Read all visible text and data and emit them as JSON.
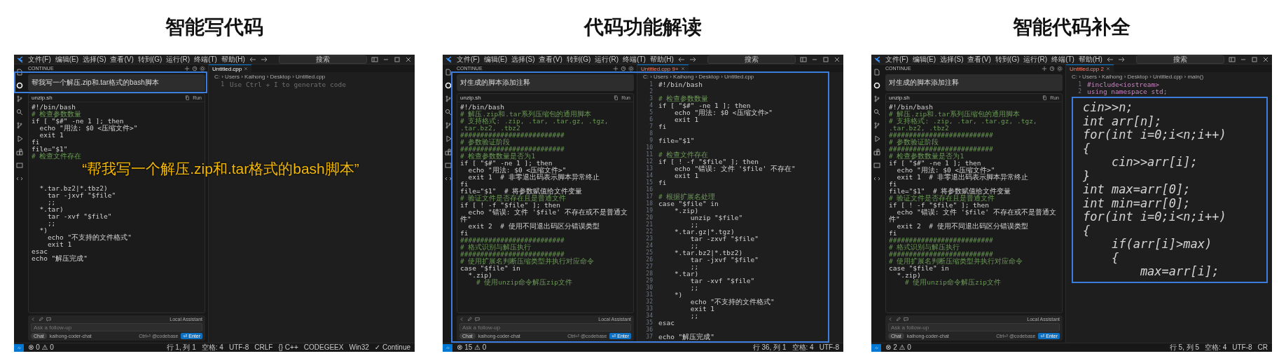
{
  "panels": [
    {
      "title": "智能写代码",
      "highlight": {
        "kind": "prompt"
      },
      "caption": "“帮我写一个解压.zip和.tar格式的bash脚本”",
      "screen": {
        "menu": [
          "文件(F)",
          "编辑(E)",
          "选择(S)",
          "查看(V)",
          "转到(G)",
          "运行(R)",
          "终端(T)",
          "帮助(H)"
        ],
        "search": "搜索",
        "sidebar_header": "CONTINUE",
        "tab": {
          "label": "Untitled.cpp"
        },
        "breadcrumb": "C: › Users › Kaihong › Desktop › Untitled.cpp",
        "prompt": "帮我写一个解压.zip和.tar格式的bash脚本",
        "code_file": "unzip.sh",
        "run": "Run",
        "chat_code": [
          {
            "text": "#!/bin/bash",
            "kind": "code"
          },
          {
            "text": "# 检查参数数量",
            "kind": "comment"
          },
          {
            "text": "if [ \"$#\" -ne 1 ]; then",
            "kind": "code"
          },
          {
            "text": "  echo \"用法: $0 <压缩文件>\"",
            "kind": "code"
          },
          {
            "text": "  exit 1",
            "kind": "code"
          },
          {
            "text": "fi",
            "kind": "code"
          },
          {
            "text": "file=\"$1\"",
            "kind": "code"
          },
          {
            "text": "# 检查文件存在",
            "kind": "comment"
          }
        ],
        "chat_code_below": [
          {
            "text": "  *.tar.bz2|*.tbz2)",
            "kind": "code"
          },
          {
            "text": "    tar -jxvf \"$file\"",
            "kind": "code"
          },
          {
            "text": "    ;;",
            "kind": "code"
          },
          {
            "text": "  *.tar)",
            "kind": "code"
          },
          {
            "text": "    tar -xvf \"$file\"",
            "kind": "code"
          },
          {
            "text": "    ;;",
            "kind": "code"
          },
          {
            "text": "  *)",
            "kind": "code"
          },
          {
            "text": "    echo \"不支持的文件格式\"",
            "kind": "code"
          },
          {
            "text": "    exit 1",
            "kind": "code"
          },
          {
            "text": "esac",
            "kind": "code"
          },
          {
            "text": "echo \"解压完成\"",
            "kind": "code"
          }
        ],
        "assistant": "Local Assistant",
        "followup_placeholder": "Ask a follow-up",
        "chat_mode": "Chat",
        "model": "kaihong-coder-chat",
        "shortcut": "Ctrl⏎ @codebase",
        "enter": "⏎ Enter",
        "editor_lines": [
          {
            "n": "1",
            "text": "Use Ctrl + I to generate code",
            "kind": "hint"
          }
        ],
        "status_left": "⊗ 0 ⚠ 0",
        "status_right": [
          "行 1, 列 1",
          "空格: 4",
          "UTF-8",
          "CRLF",
          "{} C++",
          "CODEGEEX",
          "Win32",
          "✓ Continue"
        ]
      }
    },
    {
      "title": "代码功能解读",
      "highlight": {
        "kind": "workspace"
      },
      "screen": {
        "menu": [
          "文件(F)",
          "编辑(E)",
          "选择(S)",
          "查看(V)",
          "转到(G)",
          "运行(R)",
          "终端(T)",
          "帮助(H)"
        ],
        "search": "搜索",
        "sidebar_header": "CONTINUE",
        "tab": {
          "label": "Untitled.cpp",
          "problems": "9+"
        },
        "breadcrumb": "C: › Users › Kaihong › Desktop › Untitled.cpp",
        "prompt": "对生成的脚本添加注释",
        "code_file": "unzip.sh",
        "run": "Run",
        "chat_code": [
          {
            "text": "#!/bin/bash",
            "kind": "code"
          },
          {
            "text": "# 解压.zip和.tar系列压缩包的通用脚本",
            "kind": "comment"
          },
          {
            "text": "# 支持格式: .zip, .tar, .tar.gz, .tgz, .tar.bz2, .tbz2",
            "kind": "comment"
          },
          {
            "text": "##########################",
            "kind": "comment"
          },
          {
            "text": "# 参数验证阶段",
            "kind": "comment"
          },
          {
            "text": "##########################",
            "kind": "comment"
          },
          {
            "text": "# 检查参数数量是否为1",
            "kind": "comment"
          },
          {
            "text": "if [ \"$#\" -ne 1 ]; then",
            "kind": "code"
          },
          {
            "text": "  echo \"用法: $0 <压缩文件>\"",
            "kind": "code"
          },
          {
            "text": "  exit 1  # 非零退出码表示脚本异常终止",
            "kind": "code"
          },
          {
            "text": "fi",
            "kind": "code"
          },
          {
            "text": "file=\"$1\"  # 将参数赋值给文件变量",
            "kind": "code"
          },
          {
            "text": "# 验证文件是否存在且是普通文件",
            "kind": "comment"
          },
          {
            "text": "if [ ! -f \"$file\" ]; then",
            "kind": "code"
          },
          {
            "text": "  echo \"错误: 文件 '$file' 不存在或不是普通文件\"",
            "kind": "code"
          },
          {
            "text": "  exit 2  # 使用不同退出码区分错误类型",
            "kind": "code"
          },
          {
            "text": "fi",
            "kind": "code"
          },
          {
            "text": "##########################",
            "kind": "comment"
          },
          {
            "text": "# 格式识别与解压执行",
            "kind": "comment"
          },
          {
            "text": "##########################",
            "kind": "comment"
          },
          {
            "text": "# 使用扩展名判断压缩类型并执行对应命令",
            "kind": "comment"
          },
          {
            "text": "case \"$file\" in",
            "kind": "code"
          },
          {
            "text": "  *.zip)",
            "kind": "code"
          },
          {
            "text": "    # 使用unzip命令解压zip文件",
            "kind": "comment"
          }
        ],
        "assistant": "Local Assistant",
        "followup_placeholder": "Ask a follow-up",
        "chat_mode": "Chat",
        "model": "kaihong-coder-chat",
        "shortcut": "Ctrl⏎ @codebase",
        "enter": "⏎ Enter",
        "editor_lines": [
          {
            "n": "1",
            "text": "#!/bin/bash",
            "kind": "code"
          },
          {
            "n": "2"
          },
          {
            "n": "3",
            "text": "# 检查参数数量",
            "kind": "comment"
          },
          {
            "n": "4",
            "text": "if [ \"$#\" -ne 1 ]; then",
            "kind": "code"
          },
          {
            "n": "5",
            "text": "    echo \"用法: $0 <压缩文件>\"",
            "kind": "code"
          },
          {
            "n": "6",
            "text": "    exit 1",
            "kind": "code"
          },
          {
            "n": "7",
            "text": "fi",
            "kind": "code"
          },
          {
            "n": "8"
          },
          {
            "n": "9",
            "text": "file=\"$1\"",
            "kind": "code"
          },
          {
            "n": "10"
          },
          {
            "n": "11",
            "text": "# 检查文件存在",
            "kind": "comment"
          },
          {
            "n": "12",
            "text": "if [ ! -f \"$file\" ]; then",
            "kind": "code"
          },
          {
            "n": "13",
            "text": "    echo \"错误: 文件 '$file' 不存在\"",
            "kind": "code"
          },
          {
            "n": "14",
            "text": "    exit 1",
            "kind": "code"
          },
          {
            "n": "15",
            "text": "fi",
            "kind": "code"
          },
          {
            "n": "16"
          },
          {
            "n": "17",
            "text": "# 根据扩展名处理",
            "kind": "comment"
          },
          {
            "n": "18",
            "text": "case \"$file\" in",
            "kind": "code"
          },
          {
            "n": "19",
            "text": "    *.zip)",
            "kind": "code"
          },
          {
            "n": "20",
            "text": "        unzip \"$file\"",
            "kind": "code"
          },
          {
            "n": "21",
            "text": "        ;;",
            "kind": "code"
          },
          {
            "n": "22",
            "text": "    *.tar.gz|*.tgz)",
            "kind": "code"
          },
          {
            "n": "23",
            "text": "        tar -zxvf \"$file\"",
            "kind": "code"
          },
          {
            "n": "24",
            "text": "        ;;",
            "kind": "code"
          },
          {
            "n": "25",
            "text": "    *.tar.bz2|*.tbz2)",
            "kind": "code"
          },
          {
            "n": "26",
            "text": "        tar -jxvf \"$file\"",
            "kind": "code"
          },
          {
            "n": "27",
            "text": "        ;;",
            "kind": "code"
          },
          {
            "n": "28",
            "text": "    *.tar)",
            "kind": "code"
          },
          {
            "n": "29",
            "text": "        tar -xvf \"$file\"",
            "kind": "code"
          },
          {
            "n": "30",
            "text": "        ;;",
            "kind": "code"
          },
          {
            "n": "31",
            "text": "    *)",
            "kind": "code"
          },
          {
            "n": "32",
            "text": "        echo \"不支持的文件格式\"",
            "kind": "code"
          },
          {
            "n": "33",
            "text": "        exit 1",
            "kind": "code"
          },
          {
            "n": "34",
            "text": "        ;;",
            "kind": "code"
          },
          {
            "n": "35",
            "text": "esac",
            "kind": "code"
          },
          {
            "n": "36"
          },
          {
            "n": "37",
            "text": "echo \"解压完成\"",
            "kind": "code"
          }
        ],
        "status_left": "⊗ 15 ⚠ 0",
        "status_right": [
          "行 36, 列 1",
          "空格: 4",
          "UTF-8"
        ]
      }
    },
    {
      "title": "智能代码补全",
      "screen": {
        "menu": [
          "文件(F)",
          "编辑(E)",
          "选择(S)",
          "查看(V)",
          "转到(G)",
          "运行(R)",
          "终端(T)",
          "帮助(H)"
        ],
        "search": "搜索",
        "sidebar_header": "CONTINUE",
        "tab": {
          "label": "Untitled.cpp",
          "problems": "2"
        },
        "breadcrumb": "C: › Users › Kaihong › Desktop › Untitled.cpp › main()",
        "prompt": "对生成的脚本添加注释",
        "code_file": "unzip.sh",
        "run": "Run",
        "chat_code": [
          {
            "text": "#!/bin/bash",
            "kind": "code"
          },
          {
            "text": "# 解压.zip和.tar系列压缩包的通用脚本",
            "kind": "comment"
          },
          {
            "text": "# 支持格式: .zip, .tar, .tar.gz, .tgz, .tar.bz2, .tbz2",
            "kind": "comment"
          },
          {
            "text": "##########################",
            "kind": "comment"
          },
          {
            "text": "# 参数验证阶段",
            "kind": "comment"
          },
          {
            "text": "##########################",
            "kind": "comment"
          },
          {
            "text": "# 检查参数数量是否为1",
            "kind": "comment"
          },
          {
            "text": "if [ \"$#\" -ne 1 ]; then",
            "kind": "code"
          },
          {
            "text": "  echo \"用法: $0 <压缩文件>\"",
            "kind": "code"
          },
          {
            "text": "  exit 1  # 非零退出码表示脚本异常终止",
            "kind": "code"
          },
          {
            "text": "fi",
            "kind": "code"
          },
          {
            "text": "file=\"$1\"  # 将参数赋值给文件变量",
            "kind": "code"
          },
          {
            "text": "# 验证文件是否存在且是普通文件",
            "kind": "comment"
          },
          {
            "text": "if [ ! -f \"$file\" ]; then",
            "kind": "code"
          },
          {
            "text": "  echo \"错误: 文件 '$file' 不存在或不是普通文件\"",
            "kind": "code"
          },
          {
            "text": "  exit 2  # 使用不同退出码区分错误类型",
            "kind": "code"
          },
          {
            "text": "fi",
            "kind": "code"
          },
          {
            "text": "##########################",
            "kind": "comment"
          },
          {
            "text": "# 格式识别与解压执行",
            "kind": "comment"
          },
          {
            "text": "##########################",
            "kind": "comment"
          },
          {
            "text": "# 使用扩展名判断压缩类型并执行对应命令",
            "kind": "comment"
          },
          {
            "text": "case \"$file\" in",
            "kind": "code"
          },
          {
            "text": "  *.zip)",
            "kind": "code"
          },
          {
            "text": "    # 使用unzip命令解压zip文件",
            "kind": "comment"
          }
        ],
        "assistant": "Local Assistant",
        "followup_placeholder": "Ask a follow-up",
        "chat_mode": "Chat",
        "model": "kaihong-coder-chat",
        "shortcut": "Ctrl⏎ @codebase",
        "enter": "⏎ Enter",
        "editor_lines": [
          {
            "n": "1",
            "text": "#include<iostream>",
            "kind": "error"
          },
          {
            "n": "2",
            "text": "using namespace std;",
            "kind": "error"
          }
        ],
        "status_left": "⊗ 2 ⚠ 0",
        "status_right": [
          "行 5, 列 5",
          "空格: 4",
          "UTF-8",
          "CR"
        ]
      },
      "zoom_lines": [
        "cin>>n;",
        "int arr[n];",
        "for(int i=0;i<n;i++)",
        "{",
        "    cin>>arr[i];",
        "}",
        "int max=arr[0];",
        "int min=arr[0];",
        "for(int i=0;i<n;i++)",
        "{",
        "    if(arr[i]>max)",
        "    {",
        "        max=arr[i];"
      ]
    }
  ]
}
